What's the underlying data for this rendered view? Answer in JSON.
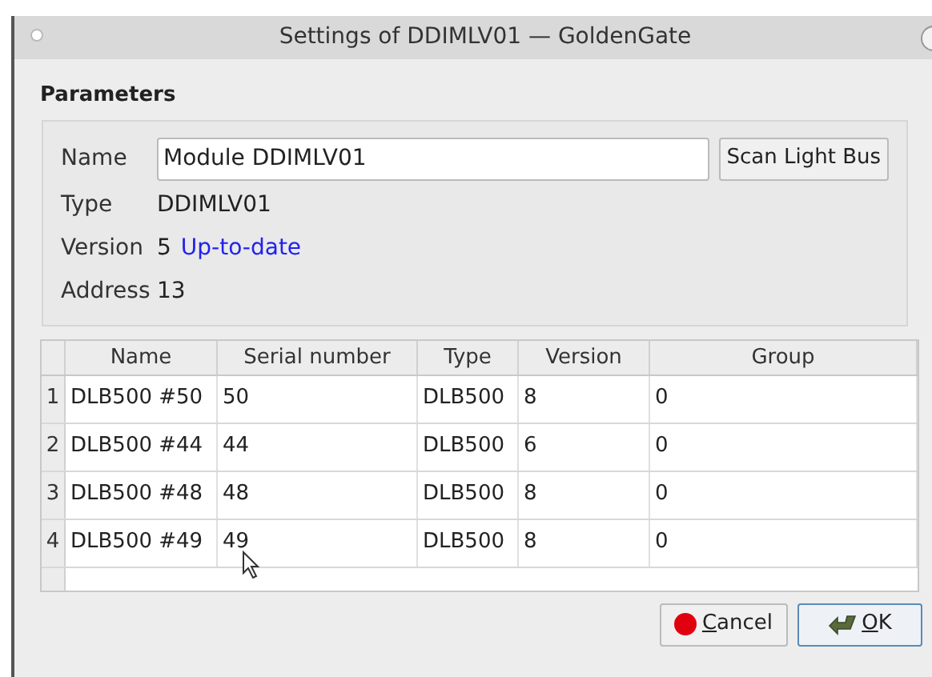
{
  "window": {
    "title": "Settings of DDIMLV01 — GoldenGate"
  },
  "parameters": {
    "title": "Parameters",
    "name": {
      "label": "Name",
      "value": "Module DDIMLV01"
    },
    "scan_button": "Scan Light Bus",
    "type": {
      "label": "Type",
      "value": "DDIMLV01"
    },
    "version": {
      "label": "Version",
      "value": "5",
      "status": "Up-to-date"
    },
    "address": {
      "label": "Address",
      "value": "13"
    }
  },
  "table": {
    "columns": [
      "Name",
      "Serial number",
      "Type",
      "Version",
      "Group"
    ],
    "rows": [
      {
        "number": "1",
        "cells": [
          "DLB500 #50",
          "50",
          "DLB500",
          "8",
          "0"
        ]
      },
      {
        "number": "2",
        "cells": [
          "DLB500 #44",
          "44",
          "DLB500",
          "6",
          "0"
        ]
      },
      {
        "number": "3",
        "cells": [
          "DLB500 #48",
          "48",
          "DLB500",
          "8",
          "0"
        ]
      },
      {
        "number": "4",
        "cells": [
          "DLB500 #49",
          "49",
          "DLB500",
          "8",
          "0"
        ]
      }
    ]
  },
  "buttons": [
    {
      "kind": "cancel",
      "label": "Cancel",
      "default": false
    },
    {
      "kind": "ok",
      "label": "OK",
      "default": true
    }
  ]
}
